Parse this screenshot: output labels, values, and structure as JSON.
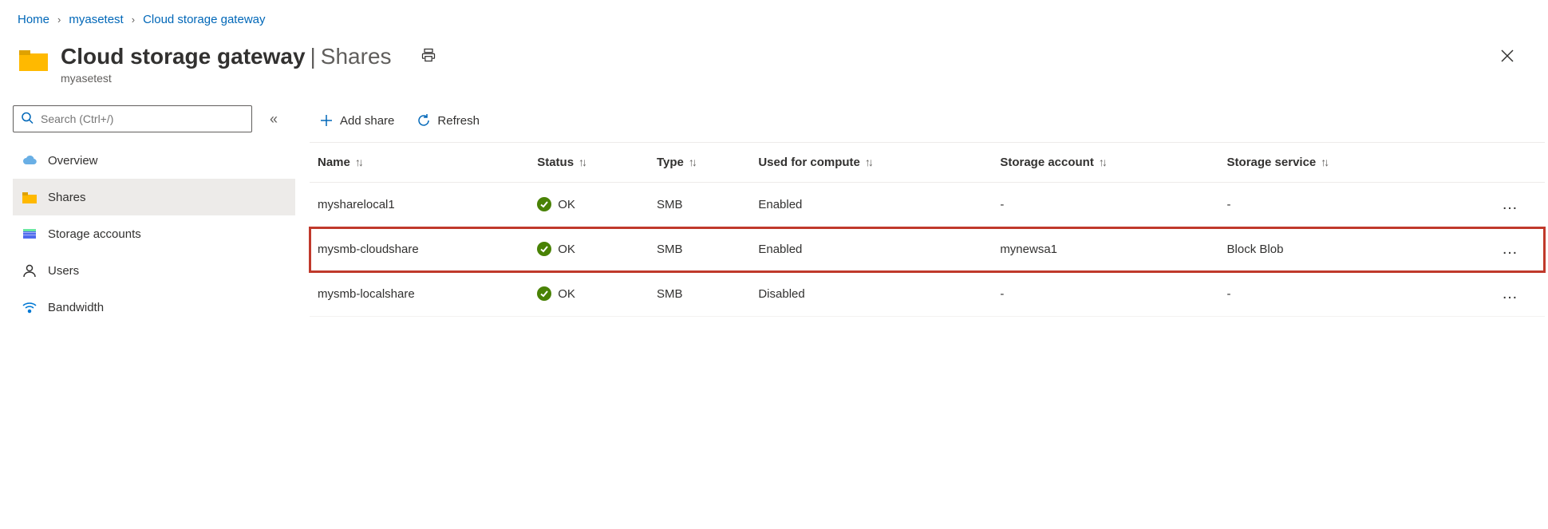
{
  "breadcrumb": {
    "home": "Home",
    "parent": "myasetest",
    "current": "Cloud storage gateway"
  },
  "header": {
    "title_main": "Cloud storage gateway",
    "title_section": "Shares",
    "subtitle": "myasetest"
  },
  "sidebar": {
    "search_placeholder": "Search (Ctrl+/)",
    "items": [
      {
        "label": "Overview"
      },
      {
        "label": "Shares"
      },
      {
        "label": "Storage accounts"
      },
      {
        "label": "Users"
      },
      {
        "label": "Bandwidth"
      }
    ]
  },
  "toolbar": {
    "add_share": "Add share",
    "refresh": "Refresh"
  },
  "table": {
    "columns": {
      "name": "Name",
      "status": "Status",
      "type": "Type",
      "used_for_compute": "Used for compute",
      "storage_account": "Storage account",
      "storage_service": "Storage service"
    },
    "rows": [
      {
        "name": "mysharelocal1",
        "status": "OK",
        "type": "SMB",
        "used_for_compute": "Enabled",
        "storage_account": "-",
        "storage_service": "-",
        "highlighted": false
      },
      {
        "name": "mysmb-cloudshare",
        "status": "OK",
        "type": "SMB",
        "used_for_compute": "Enabled",
        "storage_account": "mynewsa1",
        "storage_service": "Block Blob",
        "highlighted": true
      },
      {
        "name": "mysmb-localshare",
        "status": "OK",
        "type": "SMB",
        "used_for_compute": "Disabled",
        "storage_account": "-",
        "storage_service": "-",
        "highlighted": false
      }
    ]
  }
}
